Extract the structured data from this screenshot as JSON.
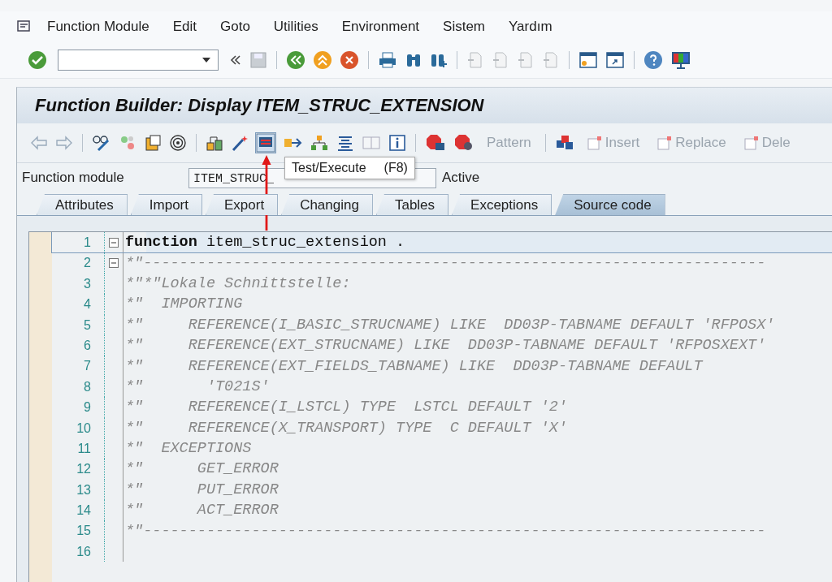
{
  "menu": [
    {
      "label": "Function Module"
    },
    {
      "label": "Edit"
    },
    {
      "label": "Goto"
    },
    {
      "label": "Utilities"
    },
    {
      "label": "Environment"
    },
    {
      "label": "Sistem"
    },
    {
      "label": "Yardım"
    }
  ],
  "title": "Function Builder: Display ITEM_STRUC_EXTENSION",
  "app_toolbar": [
    {
      "label": "Pattern",
      "disabled": true
    },
    {
      "label": "Insert",
      "disabled": true
    },
    {
      "label": "Replace",
      "disabled": true
    },
    {
      "label": "Dele",
      "disabled": true
    }
  ],
  "field": {
    "label": "Function module",
    "value": "ITEM_STRUC_",
    "status": "Active"
  },
  "tooltip": {
    "label": "Test/Execute",
    "shortcut": "(F8)"
  },
  "tabs": [
    {
      "label": "Attributes",
      "selected": false
    },
    {
      "label": "Import",
      "selected": false
    },
    {
      "label": "Export",
      "selected": false
    },
    {
      "label": "Changing",
      "selected": false
    },
    {
      "label": "Tables",
      "selected": false
    },
    {
      "label": "Exceptions",
      "selected": false
    },
    {
      "label": "Source code",
      "selected": true
    }
  ],
  "code": [
    {
      "num": "1",
      "text": "**function** item_struc_extension .",
      "kind": "code",
      "fold": true,
      "highlighted": true
    },
    {
      "num": "2",
      "text": "*\"---------------------------------------------------------------------",
      "kind": "comment",
      "fold": true,
      "highlighted": false
    },
    {
      "num": "3",
      "text": "*\"*\"Lokale Schnittstelle:",
      "kind": "comment",
      "fold": false,
      "highlighted": false
    },
    {
      "num": "4",
      "text": "*\"  IMPORTING",
      "kind": "comment",
      "fold": false,
      "highlighted": false
    },
    {
      "num": "5",
      "text": "*\"     REFERENCE(I_BASIC_STRUCNAME) LIKE  DD03P-TABNAME DEFAULT 'RFPOSX'",
      "kind": "comment",
      "fold": false,
      "highlighted": false
    },
    {
      "num": "6",
      "text": "*\"     REFERENCE(EXT_STRUCNAME) LIKE  DD03P-TABNAME DEFAULT 'RFPOSXEXT'",
      "kind": "comment",
      "fold": false,
      "highlighted": false
    },
    {
      "num": "7",
      "text": "*\"     REFERENCE(EXT_FIELDS_TABNAME) LIKE  DD03P-TABNAME DEFAULT",
      "kind": "comment",
      "fold": false,
      "highlighted": false
    },
    {
      "num": "8",
      "text": "*\"       'T021S'",
      "kind": "comment",
      "fold": false,
      "highlighted": false
    },
    {
      "num": "9",
      "text": "*\"     REFERENCE(I_LSTCL) TYPE  LSTCL DEFAULT '2'",
      "kind": "comment",
      "fold": false,
      "highlighted": false
    },
    {
      "num": "10",
      "text": "*\"     REFERENCE(X_TRANSPORT) TYPE  C DEFAULT 'X'",
      "kind": "comment",
      "fold": false,
      "highlighted": false
    },
    {
      "num": "11",
      "text": "*\"  EXCEPTIONS",
      "kind": "comment",
      "fold": false,
      "highlighted": false
    },
    {
      "num": "12",
      "text": "*\"      GET_ERROR",
      "kind": "comment",
      "fold": false,
      "highlighted": false
    },
    {
      "num": "13",
      "text": "*\"      PUT_ERROR",
      "kind": "comment",
      "fold": false,
      "highlighted": false
    },
    {
      "num": "14",
      "text": "*\"      ACT_ERROR",
      "kind": "comment",
      "fold": false,
      "highlighted": false
    },
    {
      "num": "15",
      "text": "*\"---------------------------------------------------------------------",
      "kind": "comment",
      "fold": false,
      "highlighted": false
    },
    {
      "num": "16",
      "fold": false,
      "highlighted": false
    }
  ]
}
